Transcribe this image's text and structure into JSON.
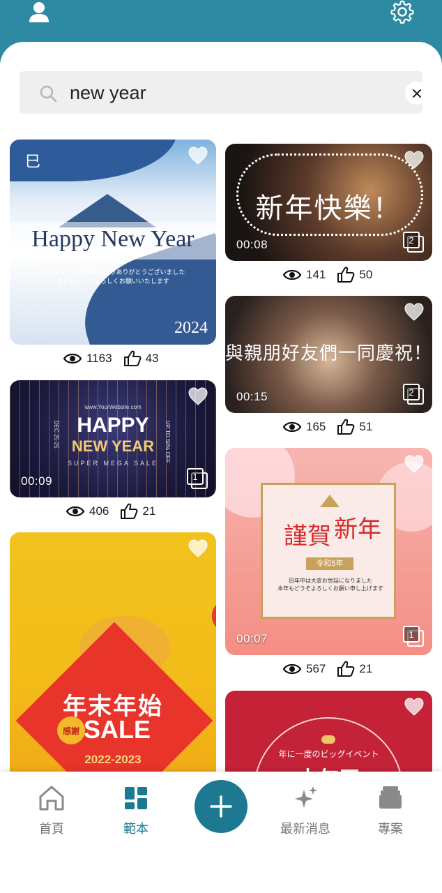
{
  "colors": {
    "header": "#2e8aa2",
    "accent": "#1d7891",
    "search_bg": "#efefef"
  },
  "header": {
    "profile_icon": "user-icon",
    "settings_icon": "gear-icon"
  },
  "search": {
    "value": "new year",
    "search_icon": "search-icon",
    "clear_icon": "close-icon"
  },
  "templates": [
    {
      "era_mark": "巳",
      "title": "Happy New Year",
      "subtitle": "旧年中は大変お世話になりありがとうございました\n本年もどうぞよろしくお願いいたします",
      "year": "2024",
      "views": "1163",
      "likes": "43"
    },
    {
      "title": "新年快樂！",
      "duration": "00:08",
      "pages": "2",
      "views": "141",
      "likes": "50"
    },
    {
      "url": "www.YourWebsite.com",
      "title1": "HAPPY",
      "title2": "NEW YEAR",
      "tagline": "SUPER MEGA SALE",
      "side_right": "UP TO 50% OFF",
      "side_left": "DEC 25-25",
      "duration": "00:09",
      "pages": "1",
      "views": "406",
      "likes": "21"
    },
    {
      "title": "與親朋好友們一同慶祝！",
      "duration": "00:15",
      "pages": "2",
      "views": "165",
      "likes": "51"
    },
    {
      "title_a": "謹賀",
      "title_b": "新年",
      "era": "令和5年",
      "subtitle": "旧年中は大変お世話になりました\n本年もどうぞよろしくお願い申し上げます",
      "duration": "00:07",
      "pages": "1",
      "views": "567",
      "likes": "21"
    },
    {
      "title": "年末年始",
      "badge": "感謝",
      "sale": "SALE",
      "years": "2022-2023"
    },
    {
      "title_small": "年に一度のビッグイベント",
      "title_big": "大年玉"
    }
  ],
  "nav": {
    "items": [
      {
        "label": "首頁",
        "icon": "home-icon"
      },
      {
        "label": "範本",
        "icon": "grid-icon"
      },
      {
        "label": "最新消息",
        "icon": "sparkle-icon"
      },
      {
        "label": "專案",
        "icon": "stack-icon"
      }
    ],
    "fab_icon": "plus-icon",
    "active": "範本"
  }
}
